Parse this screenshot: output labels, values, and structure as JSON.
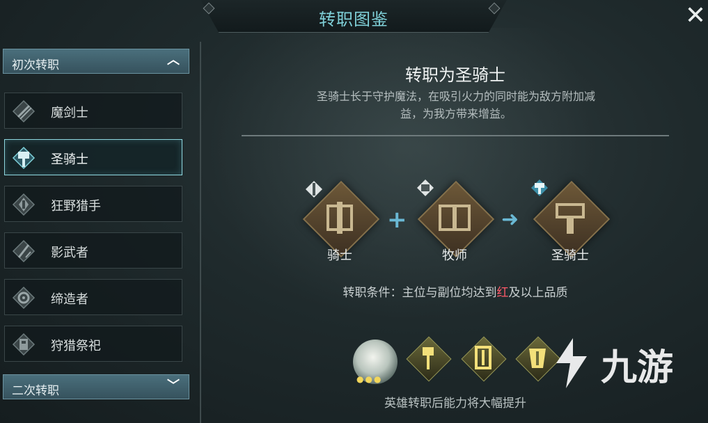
{
  "header": {
    "title": "转职图鉴"
  },
  "sections": [
    {
      "label": "初次转职",
      "expanded": true
    },
    {
      "label": "二次转职",
      "expanded": false
    }
  ],
  "jobs": [
    {
      "label": "魔剑士",
      "icon": "crossed-swords-icon",
      "selected": false
    },
    {
      "label": "圣骑士",
      "icon": "hammer-icon",
      "selected": true
    },
    {
      "label": "狂野猎手",
      "icon": "wild-emblem-icon",
      "selected": false
    },
    {
      "label": "影武者",
      "icon": "shadow-blade-icon",
      "selected": false
    },
    {
      "label": "缔造者",
      "icon": "gear-icon",
      "selected": false
    },
    {
      "label": "狩猎祭祀",
      "icon": "totem-icon",
      "selected": false
    }
  ],
  "detail": {
    "title": "转职为圣骑士",
    "description_line1": "圣骑士长于守护魔法，在吸引火力的同时能为敌方附加减",
    "description_line2": "益，为我方带来增益。",
    "formula": [
      {
        "label": "骑士",
        "icon": "knight-armor-icon",
        "badge": "sword-icon"
      },
      {
        "label": "牧师",
        "icon": "book-icon",
        "badge": "book-icon"
      },
      {
        "label": "圣骑士",
        "icon": "paladin-armor-icon",
        "badge": "hammer-icon"
      }
    ],
    "condition_prefix": "转职条件：主位与副位均达到",
    "condition_highlight": "红",
    "condition_suffix": "及以上品质",
    "rewards": [
      "crystal-orb-icon",
      "scepter-icon",
      "shield-icon",
      "armor-icon"
    ],
    "caption": "英雄转职后能力将大幅提升"
  },
  "watermark": {
    "text": "九游"
  },
  "colors": {
    "accent": "#7fd0d8",
    "highlight_red": "#ff5a6a",
    "diamond": "#6d5838"
  }
}
